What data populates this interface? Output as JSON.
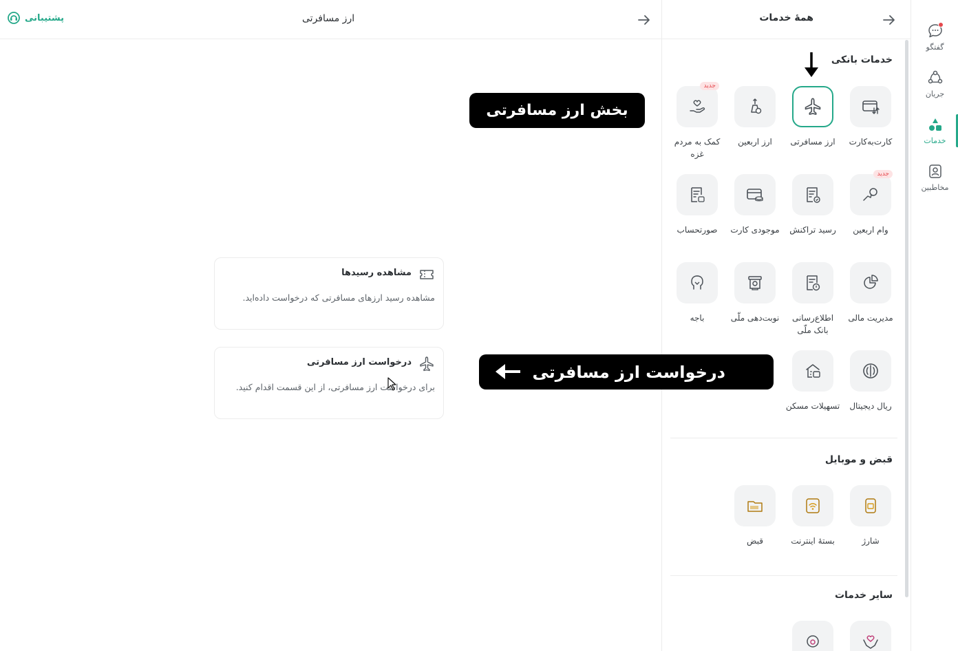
{
  "main": {
    "title": "ارز مسافرتی",
    "support_label": "پشتیبانی",
    "cards": [
      {
        "title": "مشاهده رسیدها",
        "desc": "مشاهده رسید ارزهای مسافرتی که درخواست داده‌اید."
      },
      {
        "title": "درخواست ارز مسافرتی",
        "desc": "برای درخواست ارز مسافرتی، از این قسمت اقدام کنید."
      }
    ]
  },
  "services": {
    "title": "همهٔ خدمات",
    "sections": [
      {
        "title": "خدمات بانکی",
        "items": [
          {
            "label": "کارت‌به‌کارت",
            "icon": "card-transfer-icon"
          },
          {
            "label": "ارز مسافرتی",
            "icon": "airplane-icon",
            "selected": true
          },
          {
            "label": "ارز اربعین",
            "icon": "arbaeen-icon"
          },
          {
            "label": "کمک به مردم غزه",
            "icon": "donation-hand-icon",
            "badge": "جدید"
          },
          {
            "label": "وام اربعین",
            "icon": "loan-icon",
            "badge": "جدید"
          },
          {
            "label": "رسید تراکنش",
            "icon": "receipt-icon"
          },
          {
            "label": "موجودی کارت",
            "icon": "card-balance-icon"
          },
          {
            "label": "صورتحساب",
            "icon": "statement-icon"
          },
          {
            "label": "مدیریت مالی",
            "icon": "pie-chart-icon"
          },
          {
            "label": "اطلاع‌رسانی بانک ملّی",
            "icon": "notice-icon"
          },
          {
            "label": "نوبت‌دهی ملّی",
            "icon": "appointment-icon"
          },
          {
            "label": "باجه",
            "icon": "kiosk-icon"
          },
          {
            "label": "ریال دیجیتال",
            "icon": "digital-rial-icon"
          },
          {
            "label": "تسهیلات مسکن",
            "icon": "housing-icon"
          }
        ]
      },
      {
        "title": "قبض و موبایل",
        "items": [
          {
            "label": "شارژ",
            "icon": "sim-card-icon"
          },
          {
            "label": "بستهٔ اینترنت",
            "icon": "wifi-icon"
          },
          {
            "label": "قبض",
            "icon": "bill-icon"
          }
        ]
      },
      {
        "title": "سایر خدمات",
        "items": [
          {
            "label": "",
            "icon": "charity-heart-icon"
          },
          {
            "label": "",
            "icon": "support-call-icon"
          }
        ]
      }
    ]
  },
  "rail": [
    {
      "label": "گفتگو",
      "icon": "chat-icon"
    },
    {
      "label": "جریان",
      "icon": "flow-icon"
    },
    {
      "label": "خدمات",
      "icon": "services-icon",
      "active": true
    },
    {
      "label": "مخاطبین",
      "icon": "contacts-icon"
    }
  ],
  "annotations": {
    "callout_section": "بخش ارز مسافرتی",
    "callout_request": "درخواست ارز مسافرتی"
  },
  "colors": {
    "accent": "#24a889",
    "badge": "#e5484d",
    "callout_bg": "#000000"
  }
}
